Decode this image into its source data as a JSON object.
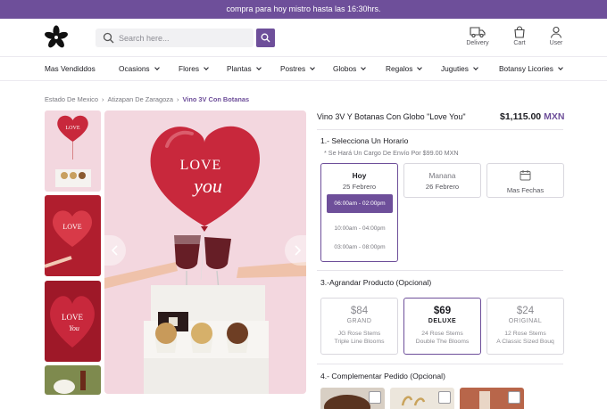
{
  "promo": {
    "text": "compra para hoy mistro hasta las 16:30hrs."
  },
  "header": {
    "search_placeholder": "Search here...",
    "icons": [
      {
        "label": "Delivery",
        "icon": "truck-icon"
      },
      {
        "label": "Cart",
        "icon": "bag-icon"
      },
      {
        "label": "User",
        "icon": "user-icon"
      }
    ]
  },
  "nav": [
    "Mas Vendiddos",
    "Ocasions",
    "Flores",
    "Plantas",
    "Postres",
    "Globos",
    "Regalos",
    "Juguties",
    "Botansy Licories"
  ],
  "breadcrumb": [
    "Estado De Mexico",
    "Atizapan De Zaragoza",
    "Vino 3V Con Botanas"
  ],
  "product": {
    "title": "Vino 3V Y Botanas Con Globo \"Love You\"",
    "price": "$1,115.00",
    "currency": "MXN"
  },
  "schedule": {
    "heading": "1.- Selecciona Un Horario",
    "note": "* Se Hará Un Cargo De Envío Por $99.00 MXN",
    "days": [
      {
        "name": "Hoy",
        "date": "25 Febrero",
        "selected": true
      },
      {
        "name": "Manana",
        "date": "26 Febrero",
        "selected": false
      }
    ],
    "more_label": "Mas Fechas",
    "slots": [
      "06:00am - 02:00pm",
      "10:00am - 04:00pm",
      "03:00am - 08:00pm"
    ],
    "active_slot": 0
  },
  "upgrade": {
    "heading": "3.-Agrandar Producto (Opcional)",
    "options": [
      {
        "price": "$84",
        "name": "GRAND",
        "line1": "JG Rose Stems",
        "line2": "Triple Line Blooms",
        "selected": false
      },
      {
        "price": "$69",
        "name": "DELUXE",
        "line1": "24 Rose Stems",
        "line2": "Double The Blooms",
        "selected": true
      },
      {
        "price": "$24",
        "name": "ORIGINAL",
        "line1": "12 Rose Stems",
        "line2": "A Classic Sized Bouq",
        "selected": false
      }
    ]
  },
  "complement": {
    "heading": "4.- Complementar Pedido (Opcional)"
  },
  "colors": {
    "accent": "#6e4f9a",
    "balloon": "#c8283c",
    "background_pink": "#f3d7df"
  }
}
